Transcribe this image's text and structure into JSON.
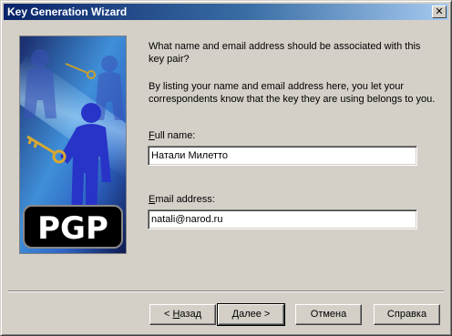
{
  "window": {
    "title": "Key Generation Wizard",
    "close_glyph": "✕"
  },
  "brand": {
    "logo_text": "PGP"
  },
  "content": {
    "prompt": "What name and email address should be associated with this key pair?",
    "hint": "By listing your name and email address here, you let your correspondents know that the key they are using belongs to you.",
    "fullname_label_mnemonic": "F",
    "fullname_label_rest": "ull name:",
    "fullname_value": "Натали Милетто",
    "email_label_mnemonic": "E",
    "email_label_rest": "mail address:",
    "email_value": "natali@narod.ru"
  },
  "buttons": {
    "back_prefix": "< ",
    "back_mnemonic": "Н",
    "back_rest": "азад",
    "next": "Далее >",
    "cancel": "Отмена",
    "help": "Справка"
  },
  "colors": {
    "title_gradient_start": "#0a246a",
    "title_gradient_end": "#a6caf0",
    "dialog_face": "#d4d0c8",
    "art_blue": "#2b3fb8"
  },
  "icons": {
    "close": "close-icon",
    "wizard_art": "pgp-wizard-illustration"
  }
}
